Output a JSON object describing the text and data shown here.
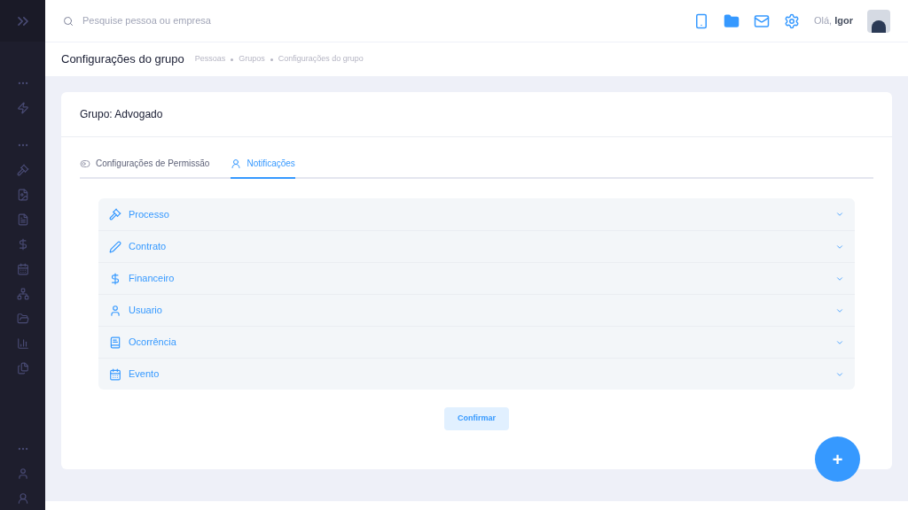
{
  "topbar": {
    "search_placeholder": "Pesquise pessoa ou empresa",
    "greeting": "Olá, **Igor**"
  },
  "page_header": {
    "title": "Configurações do grupo",
    "breadcrumbs": [
      "Pessoas",
      "Grupos",
      "Configurações do grupo"
    ]
  },
  "card": {
    "title": "Grupo: Advogado",
    "tabs": [
      {
        "label": "Configurações de Permissão",
        "kind": "toggle",
        "selected": false
      },
      {
        "label": "Notificações",
        "kind": "user",
        "selected": true
      }
    ],
    "sections": [
      {
        "label": "Processo",
        "kind": "gavel",
        "expanded": false
      },
      {
        "label": "Contrato",
        "kind": "pen",
        "expanded": false
      },
      {
        "label": "Financeiro",
        "kind": "dollar",
        "expanded": false
      },
      {
        "label": "Usuario",
        "kind": "user",
        "expanded": false
      },
      {
        "label": "Ocorrência",
        "kind": "book",
        "expanded": false
      },
      {
        "label": "Evento",
        "kind": "calendar",
        "expanded": false
      }
    ],
    "confirm_button": "Confirmar"
  },
  "fab": "+"
}
